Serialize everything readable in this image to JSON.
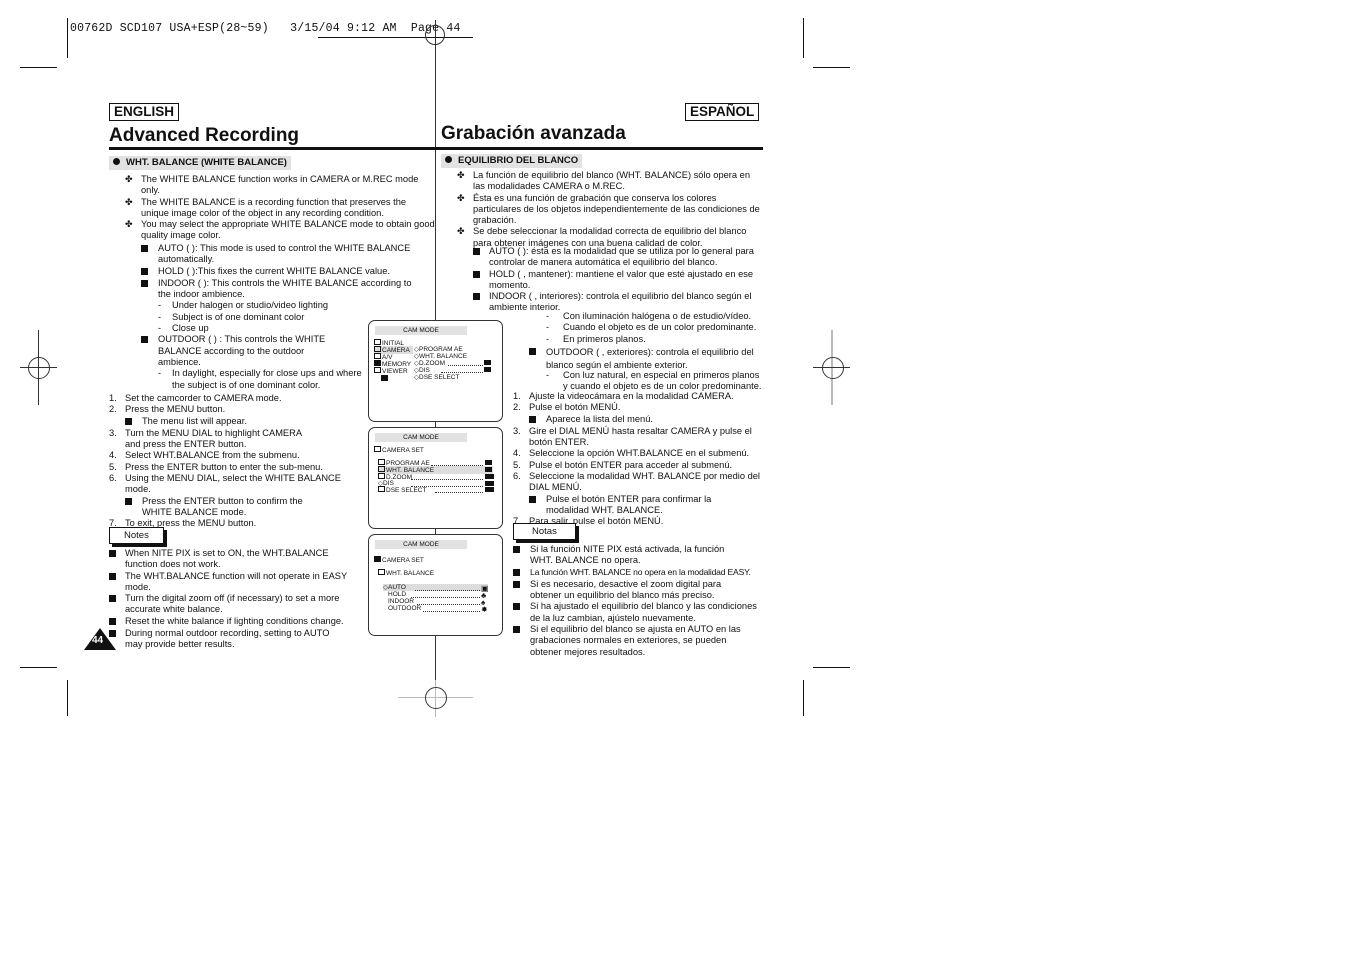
{
  "print_header": "00762D SCD107 USA+ESP(28~59)   3/15/04 9:12 AM  Page 44",
  "english": {
    "lang_tag": "ENGLISH",
    "title": "Advanced Recording",
    "section": "WHT. BALANCE (WHITE BALANCE)",
    "intro_bullets": [
      "The WHITE BALANCE function works in CAMERA or M.REC mode only.",
      "The WHITE BALANCE is a recording function that preserves the unique image color of the object in any recording condition.",
      "You may select the appropriate WHITE BALANCE mode to obtain good quality image color."
    ],
    "modes": [
      {
        "label": "AUTO",
        "icon": "auto-wb-icon",
        "text": "AUTO (  ): This mode is used to control the WHITE BALANCE automatically."
      },
      {
        "label": "HOLD",
        "icon": "hold-wb-icon",
        "text": "HOLD (  ):This fixes the current WHITE BALANCE value."
      },
      {
        "label": "INDOOR",
        "icon": "indoor-wb-icon",
        "text": "INDOOR (  ): This controls the WHITE BALANCE according to the indoor ambience."
      },
      {
        "label": "OUTDOOR",
        "icon": "outdoor-wb-icon",
        "text": "OUTDOOR (  ) : This controls the WHITE BALANCE according to the outdoor ambience."
      }
    ],
    "indoor_sub": [
      "Under halogen or studio/video lighting",
      "Subject is of one dominant color",
      "Close up"
    ],
    "outdoor_sub": [
      "In daylight, especially for close ups and where the subject is of one dominant color."
    ],
    "steps": [
      "Set the camcorder to CAMERA mode.",
      "Press the MENU button.",
      "Turn the MENU DIAL to highlight CAMERA and press the ENTER button.",
      "Select WHT.BALANCE from the submenu.",
      "Press the ENTER button to enter the sub-menu.",
      "Using the MENU DIAL, select the WHITE BALANCE mode.",
      "To exit, press the MENU button."
    ],
    "step2_sub": "The menu list will appear.",
    "step6_sub": "Press the ENTER button to confirm the WHITE BALANCE mode.",
    "notes_label": "Notes",
    "notes": [
      "When NITE PIX is set to ON, the WHT.BALANCE function does not work.",
      "The WHT.BALANCE function will not operate in EASY mode.",
      "Turn the digital zoom off (if necessary) to set a more accurate white balance.",
      "Reset the white balance if lighting conditions change.",
      "During normal outdoor recording, setting to AUTO may provide better results."
    ],
    "page_number": "44"
  },
  "screens": [
    {
      "header": "CAM MODE",
      "left_items": [
        "INITIAL",
        "CAMERA",
        "A/V",
        "MEMORY",
        "VIEWER"
      ],
      "right_items": [
        "PROGRAM AE",
        "WHT. BALANCE",
        "D.ZOOM",
        "DIS",
        "DSE SELECT"
      ],
      "highlighted": "CAMERA"
    },
    {
      "header": "CAM MODE",
      "parent": "CAMERA SET",
      "items": [
        "PROGRAM AE",
        "WHT. BALANCE",
        "D.ZOOM",
        "DIS",
        "DSE SELECT"
      ],
      "highlighted": "WHT. BALANCE"
    },
    {
      "header": "CAM MODE",
      "parent": "CAMERA SET",
      "sub_parent": "WHT. BALANCE",
      "items": [
        "AUTO",
        "HOLD",
        "INDOOR",
        "OUTDOOR"
      ],
      "highlighted": "AUTO"
    }
  ],
  "spanish": {
    "lang_tag": "ESPAÑOL",
    "title": "Grabación avanzada",
    "section": "EQUILIBRIO DEL BLANCO",
    "intro_bullets": [
      "La función de equilibrio del blanco (WHT. BALANCE) sólo opera en las modalidades CAMERA o M.REC.",
      "Ésta es una función de grabación que conserva los colores particulares de los objetos independientemente de las condiciones de grabación.",
      "Se debe seleccionar la modalidad correcta de equilibrio del blanco para obtener imágenes con una buena calidad de color."
    ],
    "modes": [
      "AUTO (  ): ésta es la modalidad que se utiliza por lo general para controlar de manera automática el equilibrio del blanco.",
      "HOLD (  , mantener): mantiene el valor que esté ajustado en ese momento.",
      "INDOOR (  , interiores): controla el equilibrio del blanco según el ambiente interior."
    ],
    "indoor_sub": [
      "Con iluminación halógena o de estudio/vídeo.",
      "Cuando el objeto es de un color predominante.",
      "En primeros planos."
    ],
    "outdoor": "OUTDOOR (  , exteriores): controla el equilibrio del blanco según el ambiente exterior.",
    "outdoor_sub": [
      "Con luz natural, en especial en primeros planos y cuando el objeto es de un color predominante."
    ],
    "steps": [
      "Ajuste la videocámara en la modalidad CAMERA.",
      "Pulse el botón MENÚ.",
      "Gire el DIAL MENÚ hasta resaltar CAMERA y pulse el botón ENTER.",
      "Seleccione la opción WHT.BALANCE en el submenú.",
      "Pulse el botón ENTER para acceder al submenú.",
      "Seleccione la modalidad WHT. BALANCE por medio del DIAL MENÚ.",
      "Para salir, pulse el botón MENÚ."
    ],
    "step2_sub": "Aparece la lista del menú.",
    "step6_sub": "Pulse el botón ENTER para confirmar la modalidad WHT. BALANCE.",
    "notes_label": "Notas",
    "notes": [
      "Si la función NITE PIX está activada, la función WHT. BALANCE no opera.",
      "La función WHT. BALANCE no opera en la modalidad EASY.",
      "Si es necesario, desactive el zoom digital para obtener un equilibrio del blanco más preciso.",
      "Si ha ajustado el equilibrio del blanco y las condiciones de la luz cambian, ajústelo nuevamente.",
      "Si el equilibrio del blanco se ajusta en AUTO en las grabaciones normales en exteriores, se pueden obtener mejores resultados."
    ]
  }
}
